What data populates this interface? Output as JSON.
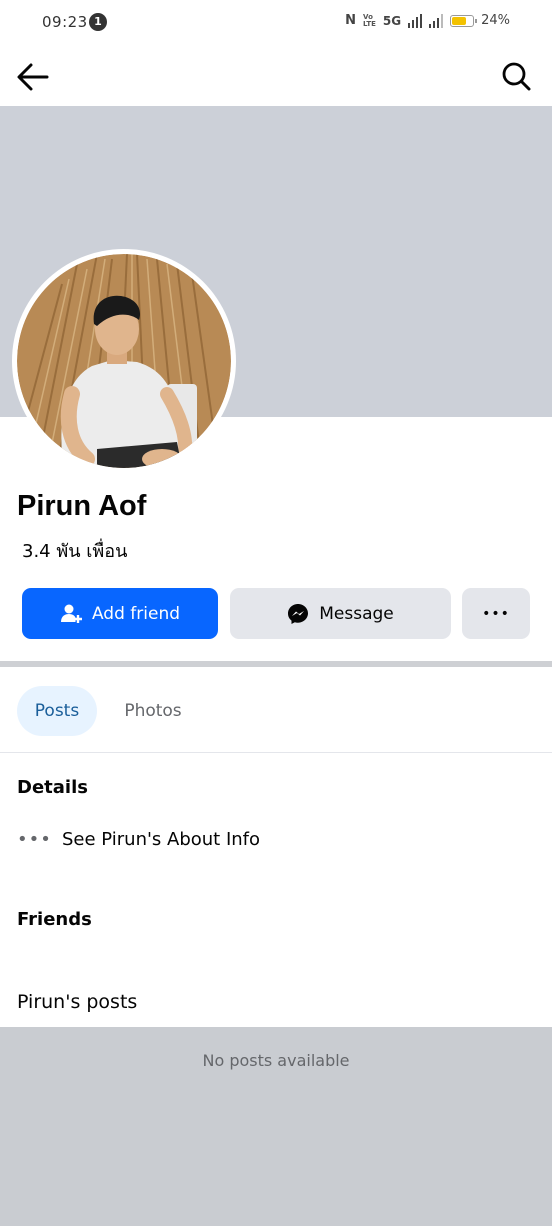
{
  "status_bar": {
    "time": "09:23",
    "notification_count": "1",
    "nfc_icon": "N",
    "volte_label": "VoLTE",
    "network": "5G",
    "battery": "24%",
    "battery_color": "#f3c200"
  },
  "top_bar": {
    "back_icon": "arrow-left",
    "search_icon": "magnifier"
  },
  "profile": {
    "name": "Pirun Aof",
    "friends_count": "3.4 พัน เพื่อน",
    "cover_color": "#ccd0d8"
  },
  "actions": {
    "add_friend": "Add friend",
    "message": "Message",
    "more": "•••",
    "primary_color": "#0866ff"
  },
  "tabs": [
    {
      "label": "Posts",
      "active": true
    },
    {
      "label": "Photos",
      "active": false
    }
  ],
  "details": {
    "title": "Details",
    "about_label": "See Pirun's About Info",
    "about_icon": "•••"
  },
  "friends": {
    "title": "Friends"
  },
  "posts": {
    "title": "Pirun's posts",
    "empty_text": "No posts available"
  }
}
